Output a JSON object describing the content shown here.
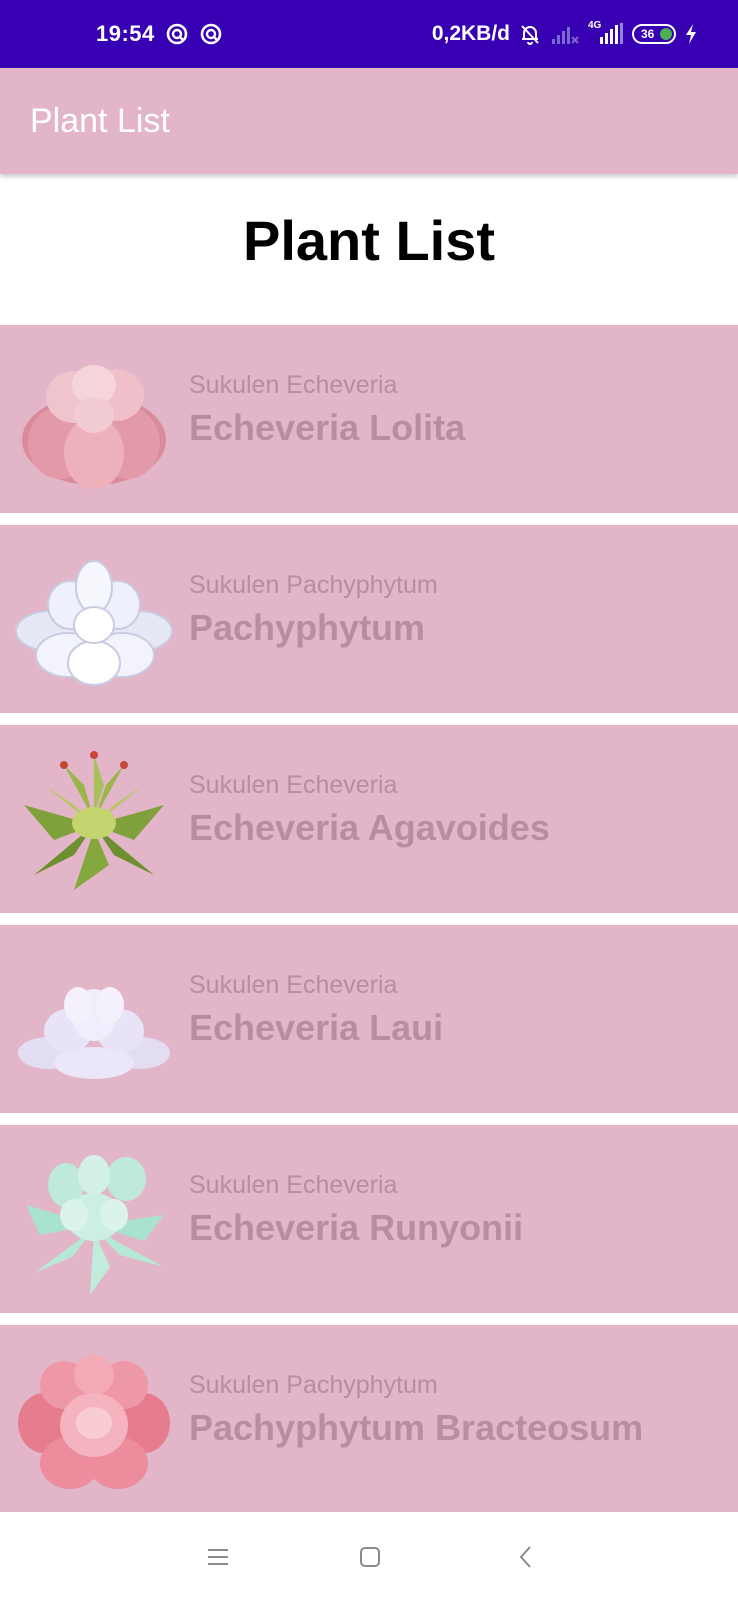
{
  "status_bar": {
    "time": "19:54",
    "speed": "0,2KB/d",
    "network": "4G",
    "battery": "36",
    "icons": [
      "app-notification-icon",
      "app-notification-icon",
      "mute-bell-icon",
      "signal-icon",
      "signal-4g-icon",
      "battery-icon",
      "charging-icon"
    ]
  },
  "app_bar": {
    "title": "Plant List"
  },
  "page": {
    "heading": "Plant List"
  },
  "plants": [
    {
      "category": "Sukulen Echeveria",
      "name": "Echeveria Lolita",
      "image": "echeveria-lolita-illustration"
    },
    {
      "category": "Sukulen Pachyphytum",
      "name": "Pachyphytum",
      "image": "pachyphytum-illustration"
    },
    {
      "category": "Sukulen Echeveria",
      "name": "Echeveria Agavoides",
      "image": "echeveria-agavoides-illustration"
    },
    {
      "category": "Sukulen Echeveria",
      "name": "Echeveria Laui",
      "image": "echeveria-laui-illustration"
    },
    {
      "category": "Sukulen Echeveria",
      "name": "Echeveria Runyonii",
      "image": "echeveria-runyonii-illustration"
    },
    {
      "category": "Sukulen Pachyphytum",
      "name": "Pachyphytum Bracteosum",
      "image": "pachyphytum-bracteosum-illustration"
    }
  ],
  "nav_bar": {
    "icons": [
      "menu-icon",
      "home-square-icon",
      "back-icon"
    ]
  },
  "colors": {
    "status_bar": "#3700b3",
    "app_bar": "#e3b5c8",
    "card": "#e3b5c8",
    "card_text": "#b98ca0"
  }
}
